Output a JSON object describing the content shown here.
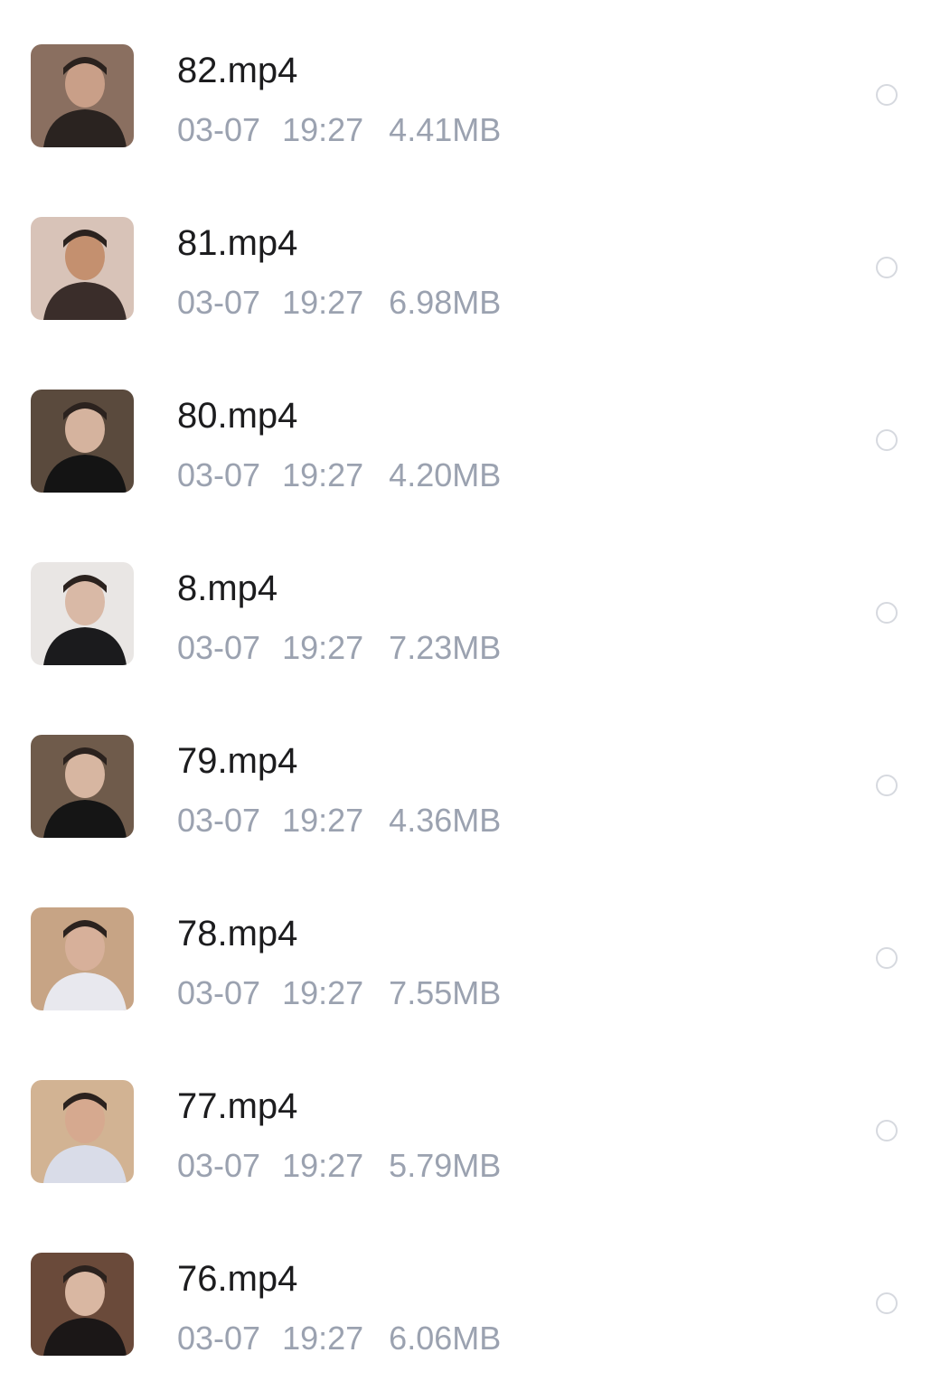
{
  "files": [
    {
      "name": "82.mp4",
      "date": "03-07",
      "time": "19:27",
      "size": "4.41MB",
      "thumb_icon": "video-thumbnail-icon",
      "thumb_colors": {
        "bg": "#8a6f60",
        "fg": "#2a2320",
        "skin": "#c99f88"
      }
    },
    {
      "name": "81.mp4",
      "date": "03-07",
      "time": "19:27",
      "size": "6.98MB",
      "thumb_icon": "video-thumbnail-icon",
      "thumb_colors": {
        "bg": "#d8c3b8",
        "fg": "#3a2d2a",
        "skin": "#c4906f"
      }
    },
    {
      "name": "80.mp4",
      "date": "03-07",
      "time": "19:27",
      "size": "4.20MB",
      "thumb_icon": "video-thumbnail-icon",
      "thumb_colors": {
        "bg": "#5a4a3d",
        "fg": "#141414",
        "skin": "#d5b39e"
      }
    },
    {
      "name": "8.mp4",
      "date": "03-07",
      "time": "19:27",
      "size": "7.23MB",
      "thumb_icon": "video-thumbnail-icon",
      "thumb_colors": {
        "bg": "#e9e6e4",
        "fg": "#1b1b1d",
        "skin": "#d9b9a6"
      }
    },
    {
      "name": "79.mp4",
      "date": "03-07",
      "time": "19:27",
      "size": "4.36MB",
      "thumb_icon": "video-thumbnail-icon",
      "thumb_colors": {
        "bg": "#6f5b4b",
        "fg": "#151515",
        "skin": "#d7b6a1"
      }
    },
    {
      "name": "78.mp4",
      "date": "03-07",
      "time": "19:27",
      "size": "7.55MB",
      "thumb_icon": "video-thumbnail-icon",
      "thumb_colors": {
        "bg": "#c7a485",
        "fg": "#e8e8ee",
        "skin": "#d7b09a"
      }
    },
    {
      "name": "77.mp4",
      "date": "03-07",
      "time": "19:27",
      "size": "5.79MB",
      "thumb_icon": "video-thumbnail-icon",
      "thumb_colors": {
        "bg": "#d2b393",
        "fg": "#d9dce8",
        "skin": "#d6a98f"
      }
    },
    {
      "name": "76.mp4",
      "date": "03-07",
      "time": "19:27",
      "size": "6.06MB",
      "thumb_icon": "video-thumbnail-icon",
      "thumb_colors": {
        "bg": "#6a4a3a",
        "fg": "#1b1717",
        "skin": "#d9b7a2"
      }
    }
  ],
  "colors": {
    "name_text": "#1c1c1e",
    "meta_text": "#9ba2b0",
    "radio_border": "#d6d9df"
  }
}
